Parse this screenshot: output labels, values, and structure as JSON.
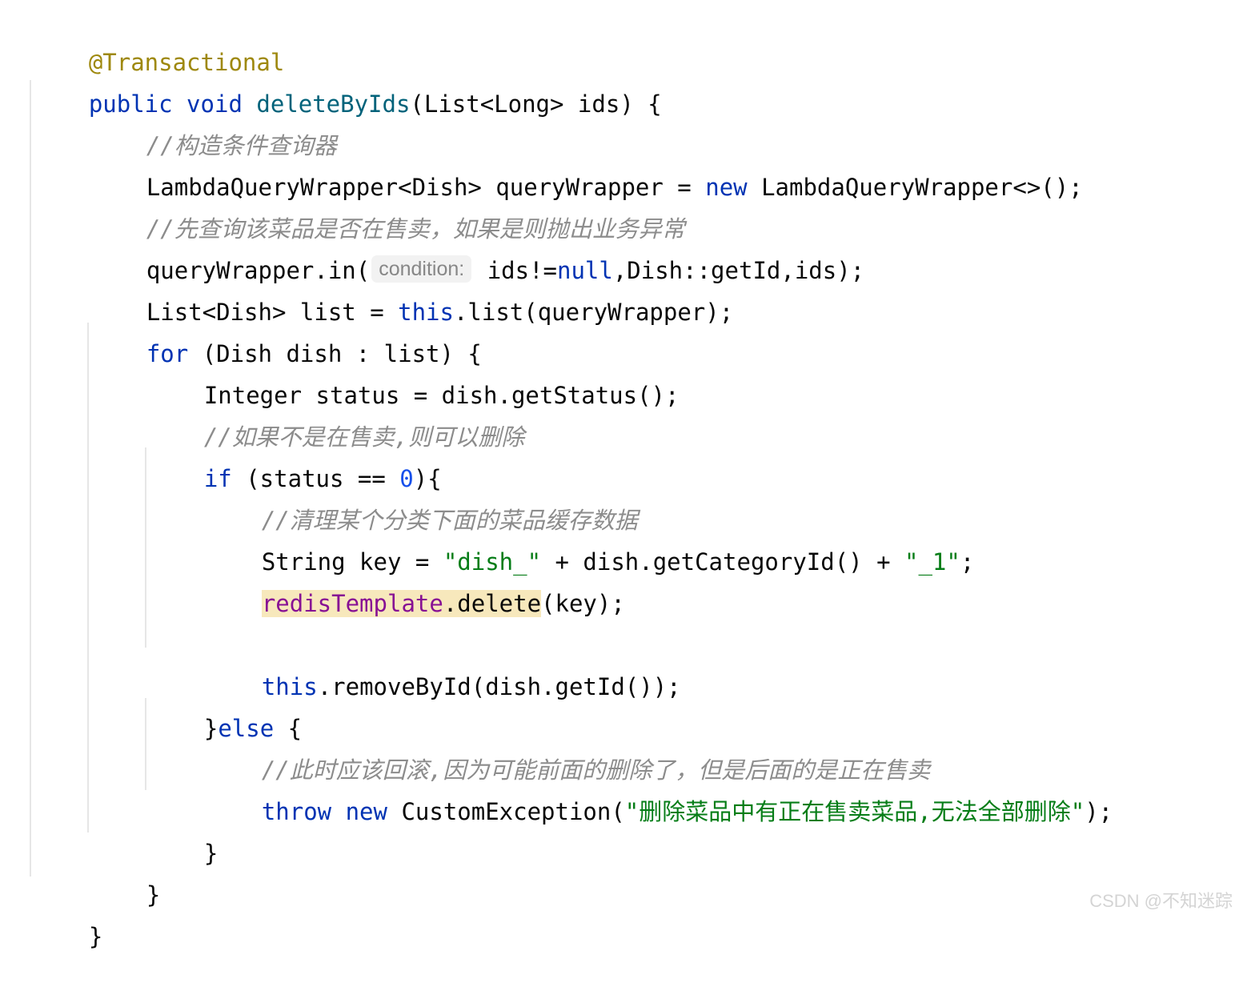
{
  "editor": {
    "language": "java",
    "background_color": "#ffffff",
    "guide_color": "#e6e6e6",
    "colors": {
      "keyword": "#0033B3",
      "annotation": "#9E880D",
      "method_declaration": "#00627A",
      "string": "#067D17",
      "number": "#1750EB",
      "field": "#871094",
      "comment": "#8C8C8C",
      "plain": "#080808",
      "inlay_hint_bg": "#f2f2f2",
      "inlay_hint_text": "#878787",
      "identifier_highlight_bg": "#f7e8bc"
    }
  },
  "code": {
    "line01": {
      "annotation": "@Transactional"
    },
    "line02": {
      "kw1": "public void ",
      "name": "deleteByIds",
      "rest": "(List<Long> ids) {"
    },
    "line03": {
      "comment": "//构造条件查询器"
    },
    "line04": {
      "a": "LambdaQueryWrapper<Dish> queryWrapper = ",
      "kw": "new",
      "b": " LambdaQueryWrapper<>();"
    },
    "line05": {
      "comment": "//先查询该菜品是否在售卖，如果是则抛出业务异常"
    },
    "line06": {
      "a": "queryWrapper.in(",
      "hint": "condition:",
      "b": " ids!=",
      "kw": "null",
      "c": ",Dish::getId,ids);"
    },
    "line07": {
      "a": "List<Dish> list = ",
      "kw": "this",
      "b": ".list(queryWrapper);"
    },
    "line08": {
      "kw": "for",
      "rest": " (Dish dish : list) {"
    },
    "line09": {
      "text": "Integer status = dish.getStatus();"
    },
    "line10": {
      "comment": "//如果不是在售卖,则可以删除"
    },
    "line11": {
      "kw": "if",
      "a": " (status == ",
      "num": "0",
      "b": "){"
    },
    "line12": {
      "comment": "//清理某个分类下面的菜品缓存数据"
    },
    "line13": {
      "a": "String key = ",
      "s1": "\"dish_\"",
      "b": " + dish.getCategoryId() + ",
      "s2": "\"_1\"",
      "c": ";"
    },
    "line14": {
      "field": "redisTemplate",
      "method": ".delete",
      "rest": "(key);"
    },
    "line15": {
      "kw": "this",
      "rest": ".removeById(dish.getId());"
    },
    "line16": {
      "brace": "}",
      "kw": "else",
      "rest": " {"
    },
    "line17": {
      "comment": "//此时应该回滚,因为可能前面的删除了，但是后面的是正在售卖"
    },
    "line18": {
      "kw": "throw new",
      "a": " CustomException(",
      "str": "\"删除菜品中有正在售卖菜品,无法全部删除\"",
      "b": ");"
    },
    "line19": {
      "text": "}"
    },
    "line20": {
      "text": "}"
    },
    "line21": {
      "text": "}"
    }
  },
  "watermark": {
    "text": "CSDN @不知迷踪"
  }
}
